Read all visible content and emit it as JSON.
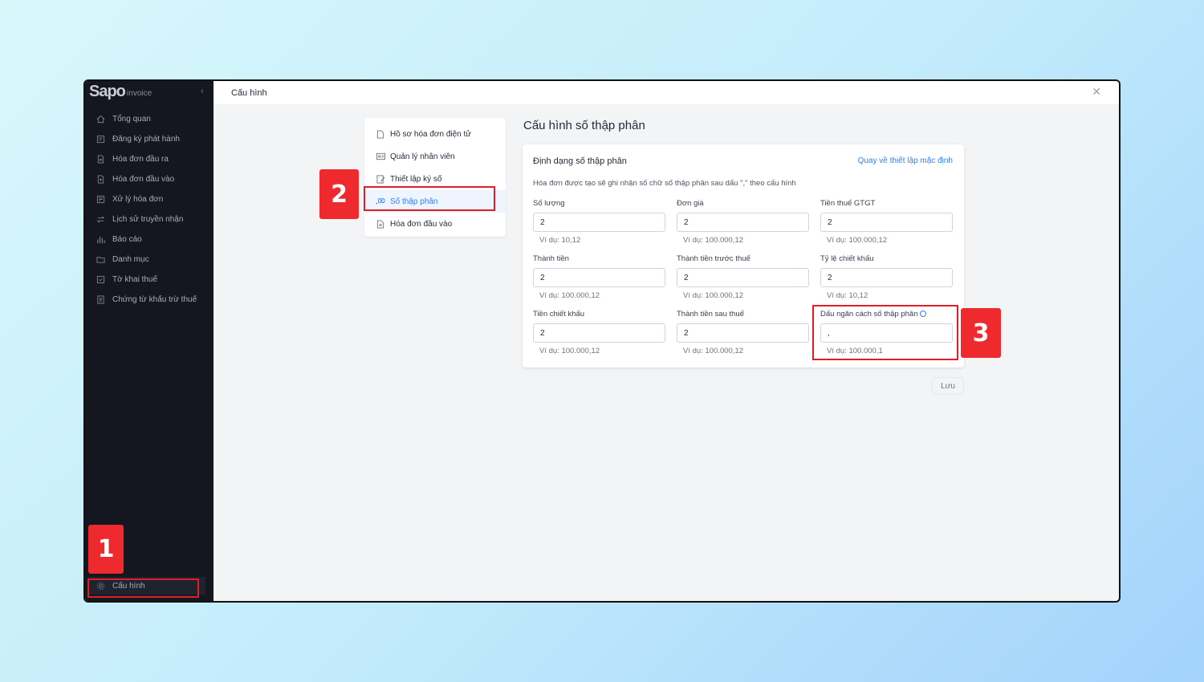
{
  "app": {
    "logo_text": "Sapo",
    "logo_sub": "invoice",
    "collapse_glyph": "‹"
  },
  "sidebar": {
    "items": [
      {
        "label": "Tổng quan",
        "icon": "home-icon"
      },
      {
        "label": "Đăng ký phát hành",
        "icon": "register-icon"
      },
      {
        "label": "Hóa đơn đầu ra",
        "icon": "document-icon"
      },
      {
        "label": "Hóa đơn đầu vào",
        "icon": "document-in-icon"
      },
      {
        "label": "Xử lý hóa đơn",
        "icon": "process-icon"
      },
      {
        "label": "Lịch sử truyền nhận",
        "icon": "transfer-icon"
      },
      {
        "label": "Báo cáo",
        "icon": "chart-icon"
      },
      {
        "label": "Danh mục",
        "icon": "folder-icon"
      },
      {
        "label": "Tờ khai thuế",
        "icon": "tax-form-icon"
      },
      {
        "label": "Chứng từ khấu trừ thuế",
        "icon": "receipt-icon"
      }
    ],
    "bottom_item": {
      "label": "Cấu hình",
      "icon": "gear-icon"
    }
  },
  "topbar": {
    "title": "Cấu hình",
    "close_glyph": "✕"
  },
  "submenu": {
    "items": [
      {
        "label": "Hồ sơ hóa đơn điện tử",
        "icon": "file-icon"
      },
      {
        "label": "Quản lý nhân viên",
        "icon": "id-card-icon"
      },
      {
        "label": "Thiết lập ký số",
        "icon": "sign-icon"
      },
      {
        "label": "Số thập phân",
        "icon": "decimal-icon"
      },
      {
        "label": "Hóa đơn đầu vào",
        "icon": "file-plus-icon"
      }
    ],
    "active_index": 3
  },
  "main": {
    "page_title": "Cấu hình số thập phân",
    "card_title": "Định dạng số thập phân",
    "reset_link": "Quay về thiết lập mặc định",
    "description": "Hóa đơn được tạo sẽ ghi nhận số chữ số thập phân sau dấu \",\" theo cấu hình",
    "fields": [
      {
        "label": "Số lượng",
        "value": "2",
        "hint": "Ví dụ: 10,12"
      },
      {
        "label": "Đơn giá",
        "value": "2",
        "hint": "Ví dụ: 100.000,12"
      },
      {
        "label": "Tiền thuế GTGT",
        "value": "2",
        "hint": "Ví dụ: 100.000,12"
      },
      {
        "label": "Thành tiền",
        "value": "2",
        "hint": "Ví dụ: 100.000,12"
      },
      {
        "label": "Thành tiền trước thuế",
        "value": "2",
        "hint": "Ví dụ: 100.000,12"
      },
      {
        "label": "Tỷ lệ chiết khấu",
        "value": "2",
        "hint": "Ví dụ: 10,12"
      },
      {
        "label": "Tiền chiết khấu",
        "value": "2",
        "hint": "Ví dụ: 100.000,12"
      },
      {
        "label": "Thành tiền sau thuế",
        "value": "2",
        "hint": "Ví dụ: 100.000,12"
      },
      {
        "label": "Dấu ngăn cách số thập phân",
        "value": ",",
        "hint": "Ví dụ: 100.000,1"
      }
    ],
    "save_label": "Lưu"
  },
  "annotations": {
    "badge_1": "1",
    "badge_2": "2",
    "badge_3": "3",
    "highlight_color": "#e11d27",
    "badge_color": "#ee2a2f"
  },
  "colors": {
    "accent": "#2d7ff9",
    "sidebar_bg": "#14171f"
  }
}
